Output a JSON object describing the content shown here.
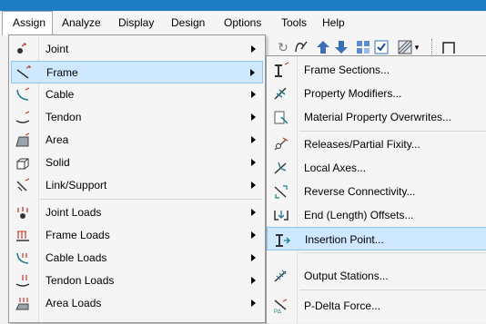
{
  "menubar": {
    "items": [
      "Assign",
      "Analyze",
      "Display",
      "Design",
      "Options",
      "Tools",
      "Help"
    ]
  },
  "assign_menu": {
    "items": [
      {
        "label": "Joint",
        "icon": "joint-icon"
      },
      {
        "label": "Frame",
        "icon": "frame-icon",
        "highlighted": true
      },
      {
        "label": "Cable",
        "icon": "cable-icon"
      },
      {
        "label": "Tendon",
        "icon": "tendon-icon"
      },
      {
        "label": "Area",
        "icon": "area-icon"
      },
      {
        "label": "Solid",
        "icon": "solid-icon"
      },
      {
        "label": "Link/Support",
        "icon": "link-support-icon"
      },
      {
        "label": "Joint Loads",
        "icon": "joint-loads-icon"
      },
      {
        "label": "Frame Loads",
        "icon": "frame-loads-icon"
      },
      {
        "label": "Cable Loads",
        "icon": "cable-loads-icon"
      },
      {
        "label": "Tendon Loads",
        "icon": "tendon-loads-icon"
      },
      {
        "label": "Area Loads",
        "icon": "area-loads-icon"
      }
    ]
  },
  "frame_submenu": {
    "items": [
      {
        "label": "Frame Sections...",
        "icon": "frame-sections-icon"
      },
      {
        "label": "Property Modifiers...",
        "icon": "property-modifiers-icon"
      },
      {
        "label": "Material Property Overwrites...",
        "icon": "material-overwrites-icon"
      },
      {
        "label": "Releases/Partial Fixity...",
        "icon": "releases-icon"
      },
      {
        "label": "Local Axes...",
        "icon": "local-axes-icon"
      },
      {
        "label": "Reverse Connectivity...",
        "icon": "reverse-connectivity-icon"
      },
      {
        "label": "End (Length) Offsets...",
        "icon": "end-offsets-icon"
      },
      {
        "label": "Insertion Point...",
        "icon": "insertion-point-icon",
        "highlighted": true
      },
      {
        "label": "Output Stations...",
        "icon": "output-stations-icon"
      },
      {
        "label": "P-Delta Force...",
        "icon": "p-delta-icon"
      }
    ]
  },
  "colors": {
    "highlight": "#cde8ff",
    "highlight_border": "#8fc3f2",
    "titlebar": "#1d7cc3"
  }
}
